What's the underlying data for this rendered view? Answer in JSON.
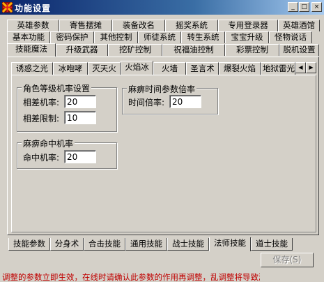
{
  "window": {
    "title": "功能设置",
    "buttons": {
      "minimize": "_",
      "maximize": "□",
      "close": "×"
    }
  },
  "top_tabs": {
    "row1": [
      "英雄参数",
      "寄售摆摊",
      "装备改名",
      "摇奖系统",
      "专用登录器",
      "英雄酒馆"
    ],
    "row2": [
      "基本功能",
      "密码保护",
      "其他控制",
      "师徒系统",
      "转生系统",
      "宝宝升级",
      "怪物说话"
    ],
    "row3": [
      "技能魔法",
      "升级武器",
      "挖矿控制",
      "祝福油控制",
      "彩票控制",
      "脱机设置"
    ],
    "active": "技能魔法"
  },
  "skill_tabs": {
    "items": [
      "诱惑之光",
      "冰咆哮",
      "灭天火",
      "火焰冰",
      "火墙",
      "圣言术",
      "爆裂火焰",
      "地狱雷光"
    ],
    "active": "火焰冰",
    "scroll_left": "◀",
    "scroll_right": "▶"
  },
  "level_group": {
    "title": "角色等级机率设置",
    "rate_label": "相差机率:",
    "rate_value": "20",
    "limit_label": "相差限制:",
    "limit_value": "10"
  },
  "paralysis_time_group": {
    "title": "麻痹时间参数倍率",
    "time_label": "时间倍率:",
    "time_value": "20"
  },
  "paralysis_hit_group": {
    "title": "麻痹命中机率",
    "hit_label": "命中机率:",
    "hit_value": "20"
  },
  "bottom_tabs": {
    "items": [
      "技能参数",
      "分身术",
      "合击技能",
      "通用技能",
      "战士技能",
      "法师技能",
      "道士技能"
    ],
    "active": "法师技能"
  },
  "footer": {
    "status_text": "调整的参数立即生效，在线时请确认此参数的作用再调整，乱调整将导致游戏混乱。",
    "save_button": "保存(S)"
  },
  "colors": {
    "titlebar_start": "#0a246a",
    "titlebar_end": "#a6caf0",
    "face": "#d4d0c8",
    "status_text": "#c00000"
  }
}
